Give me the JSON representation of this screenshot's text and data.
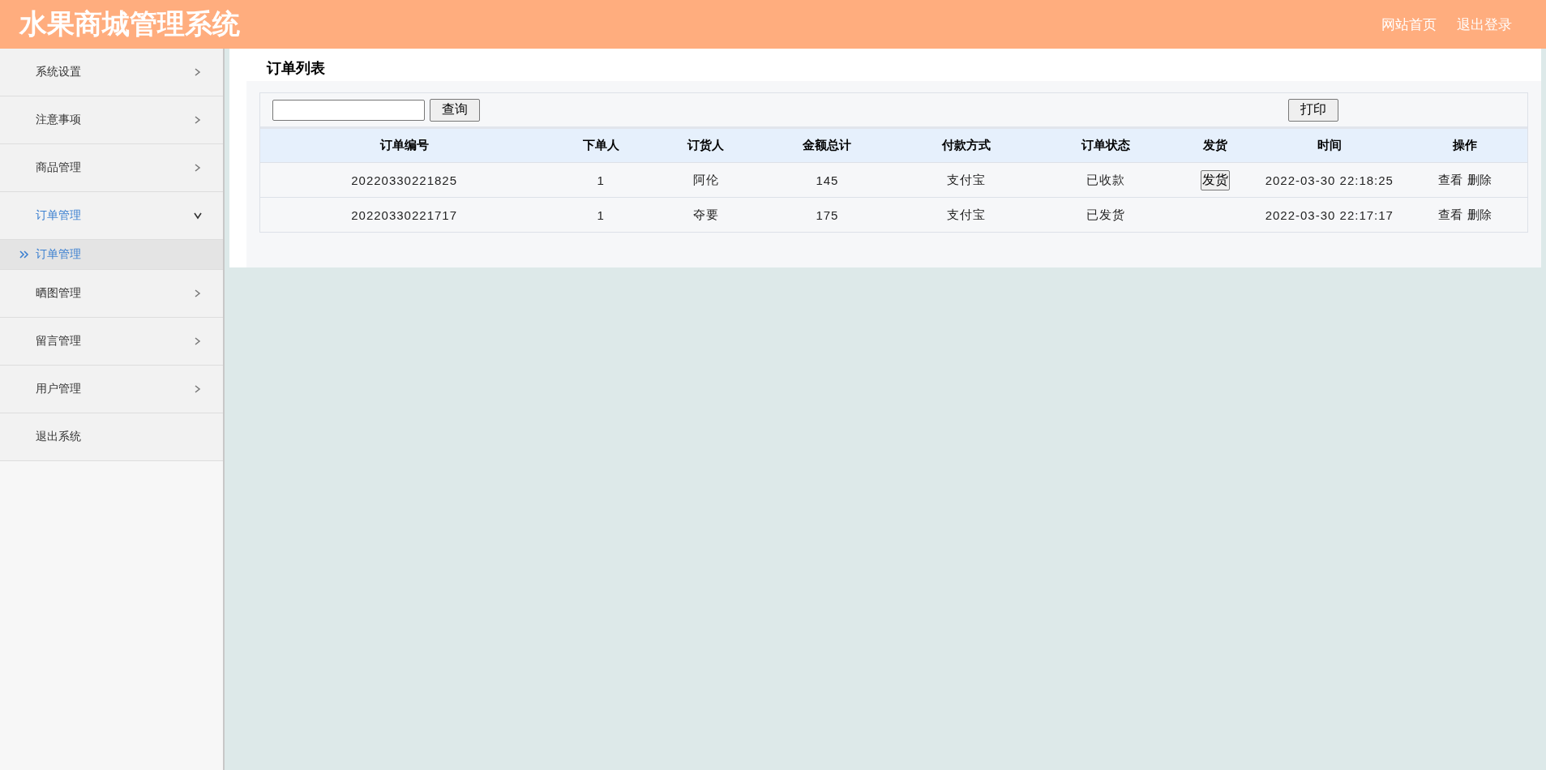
{
  "header": {
    "title": "水果商城管理系统",
    "links": [
      "网站首页",
      "退出登录"
    ]
  },
  "sidebar": {
    "items": [
      {
        "label": "系统设置",
        "kind": "menu",
        "expanded": false
      },
      {
        "label": "注意事项",
        "kind": "menu",
        "expanded": false
      },
      {
        "label": "商品管理",
        "kind": "menu",
        "expanded": false
      },
      {
        "label": "订单管理",
        "kind": "menu",
        "expanded": true,
        "children": [
          {
            "label": "订单管理",
            "selected": true
          }
        ]
      },
      {
        "label": "晒图管理",
        "kind": "menu",
        "expanded": false
      },
      {
        "label": "留言管理",
        "kind": "menu",
        "expanded": false
      },
      {
        "label": "用户管理",
        "kind": "menu",
        "expanded": false
      },
      {
        "label": "退出系统",
        "kind": "link"
      }
    ]
  },
  "page": {
    "title": "订单列表",
    "search_button": "查询",
    "print_button": "打印"
  },
  "table": {
    "columns": [
      "订单编号",
      "下单人",
      "订货人",
      "金额总计",
      "付款方式",
      "订单状态",
      "发货",
      "时间",
      "操作"
    ],
    "rows": [
      {
        "cells": [
          "20220330221825",
          "1",
          "阿伦",
          "145",
          "支付宝",
          "已收款"
        ],
        "ship_button": "发货",
        "time": "2022-03-30 22:18:25",
        "actions": [
          "查看",
          "删除"
        ]
      },
      {
        "cells": [
          "20220330221717",
          "1",
          "夺要",
          "175",
          "支付宝",
          "已发货"
        ],
        "time": "2022-03-30 22:17:17",
        "actions": [
          "查看",
          "删除"
        ]
      }
    ]
  }
}
